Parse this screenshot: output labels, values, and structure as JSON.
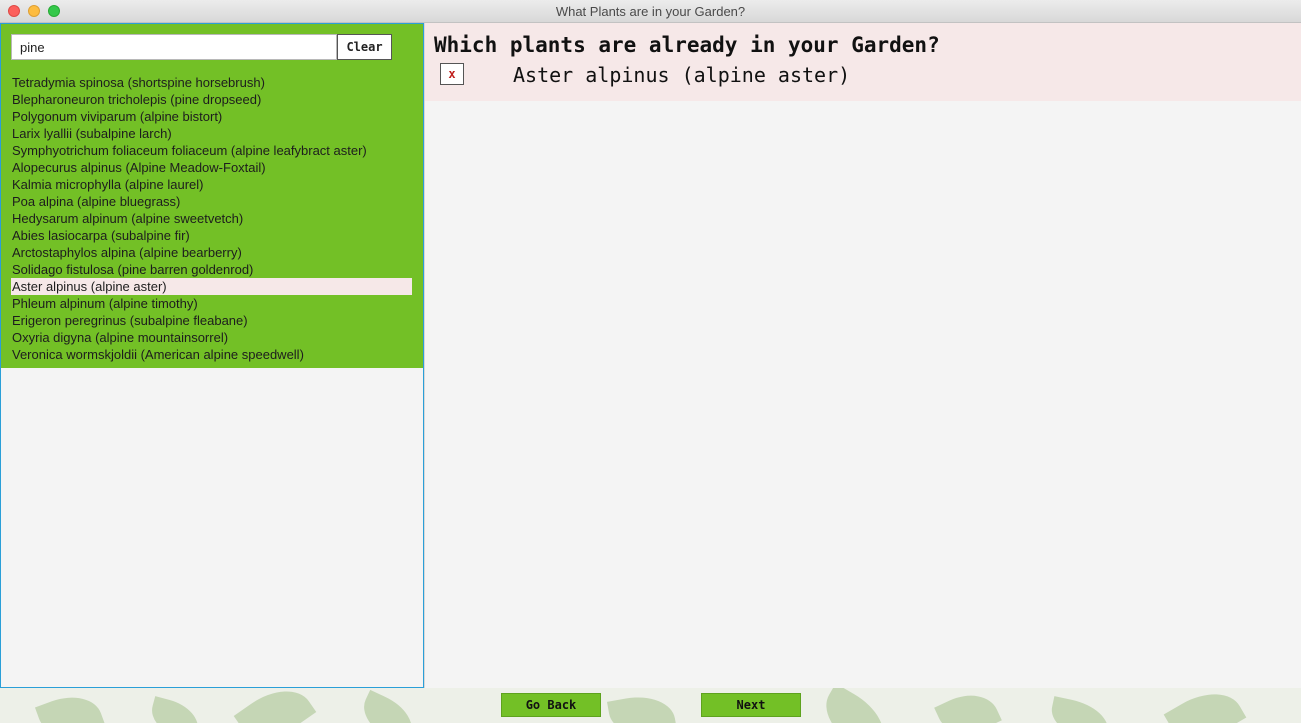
{
  "window": {
    "title": "What Plants are in your Garden?"
  },
  "search": {
    "value": "pine",
    "clear_label": "Clear"
  },
  "plants": [
    {
      "label": "Tetradymia spinosa (shortspine horsebrush)",
      "selected": false
    },
    {
      "label": "Blepharoneuron tricholepis (pine dropseed)",
      "selected": false
    },
    {
      "label": "Polygonum viviparum (alpine bistort)",
      "selected": false
    },
    {
      "label": "Larix lyallii (subalpine larch)",
      "selected": false
    },
    {
      "label": "Symphyotrichum foliaceum foliaceum (alpine leafybract aster)",
      "selected": false
    },
    {
      "label": "Alopecurus alpinus (Alpine Meadow-Foxtail)",
      "selected": false
    },
    {
      "label": "Kalmia microphylla (alpine laurel)",
      "selected": false
    },
    {
      "label": "Poa alpina (alpine bluegrass)",
      "selected": false
    },
    {
      "label": "Hedysarum alpinum (alpine sweetvetch)",
      "selected": false
    },
    {
      "label": "Abies lasiocarpa (subalpine fir)",
      "selected": false
    },
    {
      "label": "Arctostaphylos alpina (alpine bearberry)",
      "selected": false
    },
    {
      "label": "Solidago fistulosa (pine barren goldenrod)",
      "selected": false
    },
    {
      "label": "Aster alpinus (alpine aster)",
      "selected": true
    },
    {
      "label": "Phleum alpinum (alpine timothy)",
      "selected": false
    },
    {
      "label": "Erigeron peregrinus (subalpine fleabane)",
      "selected": false
    },
    {
      "label": "Oxyria digyna (alpine mountainsorrel)",
      "selected": false
    },
    {
      "label": "Veronica wormskjoldii (American alpine speedwell)",
      "selected": false
    }
  ],
  "garden": {
    "heading": "Which plants are already in your Garden?",
    "items": [
      {
        "remove_label": "x",
        "name": "Aster alpinus (alpine aster)"
      }
    ]
  },
  "nav": {
    "back_label": "Go Back",
    "next_label": "Next"
  },
  "colors": {
    "accent_green": "#73c026",
    "selected_bg": "#f6e8e8",
    "focus_border": "#2a9fd8",
    "remove_x": "#c0201e"
  }
}
